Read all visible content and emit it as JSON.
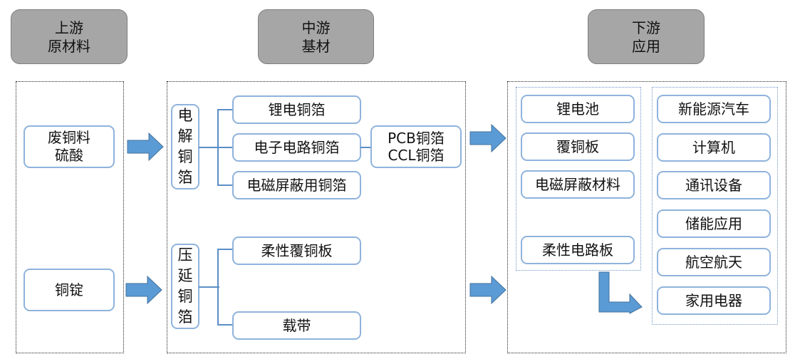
{
  "stages": [
    {
      "line1": "上游",
      "line2": "原材料"
    },
    {
      "line1": "中游",
      "line2": "基材"
    },
    {
      "line1": "下游",
      "line2": "应用"
    }
  ],
  "upstream": {
    "items": [
      {
        "lines": [
          "废铜料",
          "硫酸"
        ]
      },
      {
        "lines": [
          "铜锭"
        ]
      }
    ]
  },
  "midstream": {
    "electrolytic": {
      "label_chars": [
        "电",
        "解",
        "铜",
        "箔"
      ],
      "children": [
        "锂电铜箔",
        "电子电路铜箔",
        "电磁屏蔽用铜箔"
      ],
      "sub": {
        "lines": [
          "PCB铜箔",
          "CCL铜箔"
        ]
      }
    },
    "rolled": {
      "label_chars": [
        "压",
        "延",
        "铜",
        "箔"
      ],
      "children": [
        "柔性覆铜板",
        "载带"
      ]
    }
  },
  "downstream": {
    "products": [
      "锂电池",
      "覆铜板",
      "电磁屏蔽材料",
      "柔性电路板"
    ],
    "applications": [
      "新能源汽车",
      "计算机",
      "通讯设备",
      "储能应用",
      "航空航天",
      "家用电器"
    ]
  },
  "icons": {
    "flow_arrow": "right-block-arrow",
    "bent_arrow": "down-right-bent-arrow"
  }
}
